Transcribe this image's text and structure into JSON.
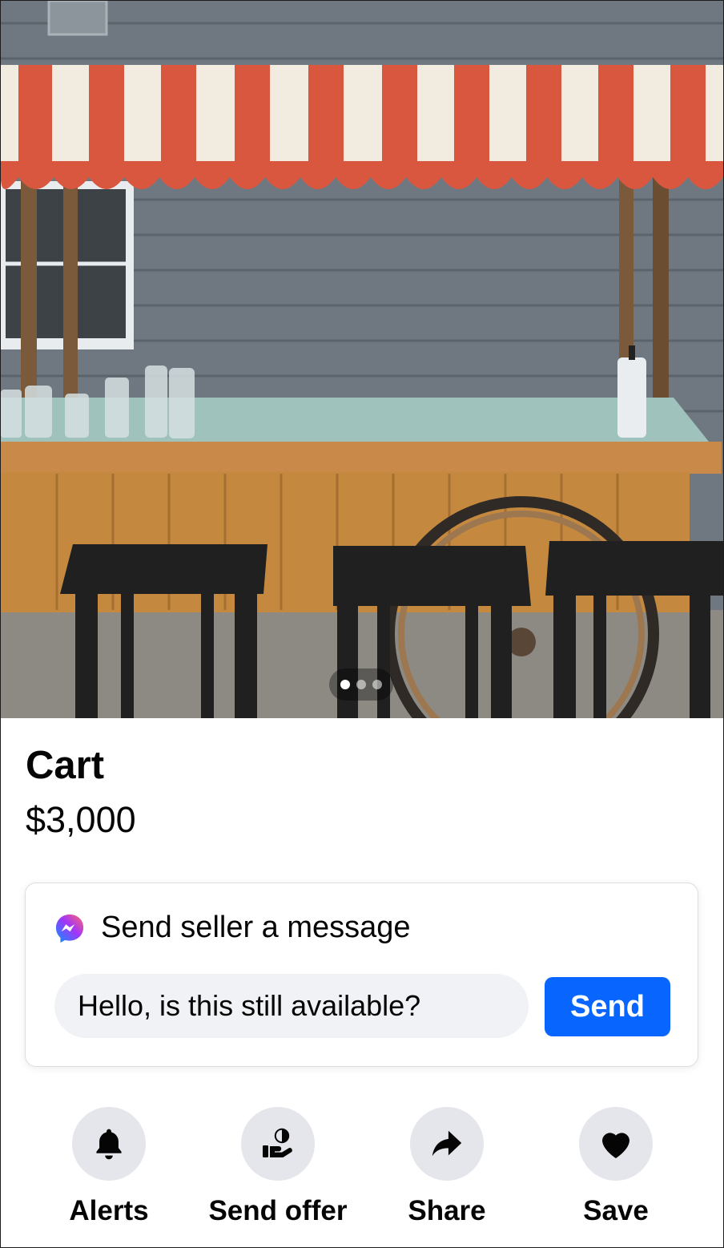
{
  "listing": {
    "title": "Cart",
    "price": "$3,000",
    "photo": {
      "icon": "listing-photo",
      "pager": {
        "count": 3,
        "active_index": 0
      }
    }
  },
  "message_card": {
    "title": "Send seller a message",
    "icon": "messenger-icon",
    "input_value": "Hello, is this still available?",
    "send_label": "Send",
    "accent_color": "#0866ff"
  },
  "actions": [
    {
      "label": "Alerts",
      "icon": "bell-icon"
    },
    {
      "label": "Send offer",
      "icon": "offer-icon"
    },
    {
      "label": "Share",
      "icon": "share-icon"
    },
    {
      "label": "Save",
      "icon": "heart-icon"
    }
  ]
}
